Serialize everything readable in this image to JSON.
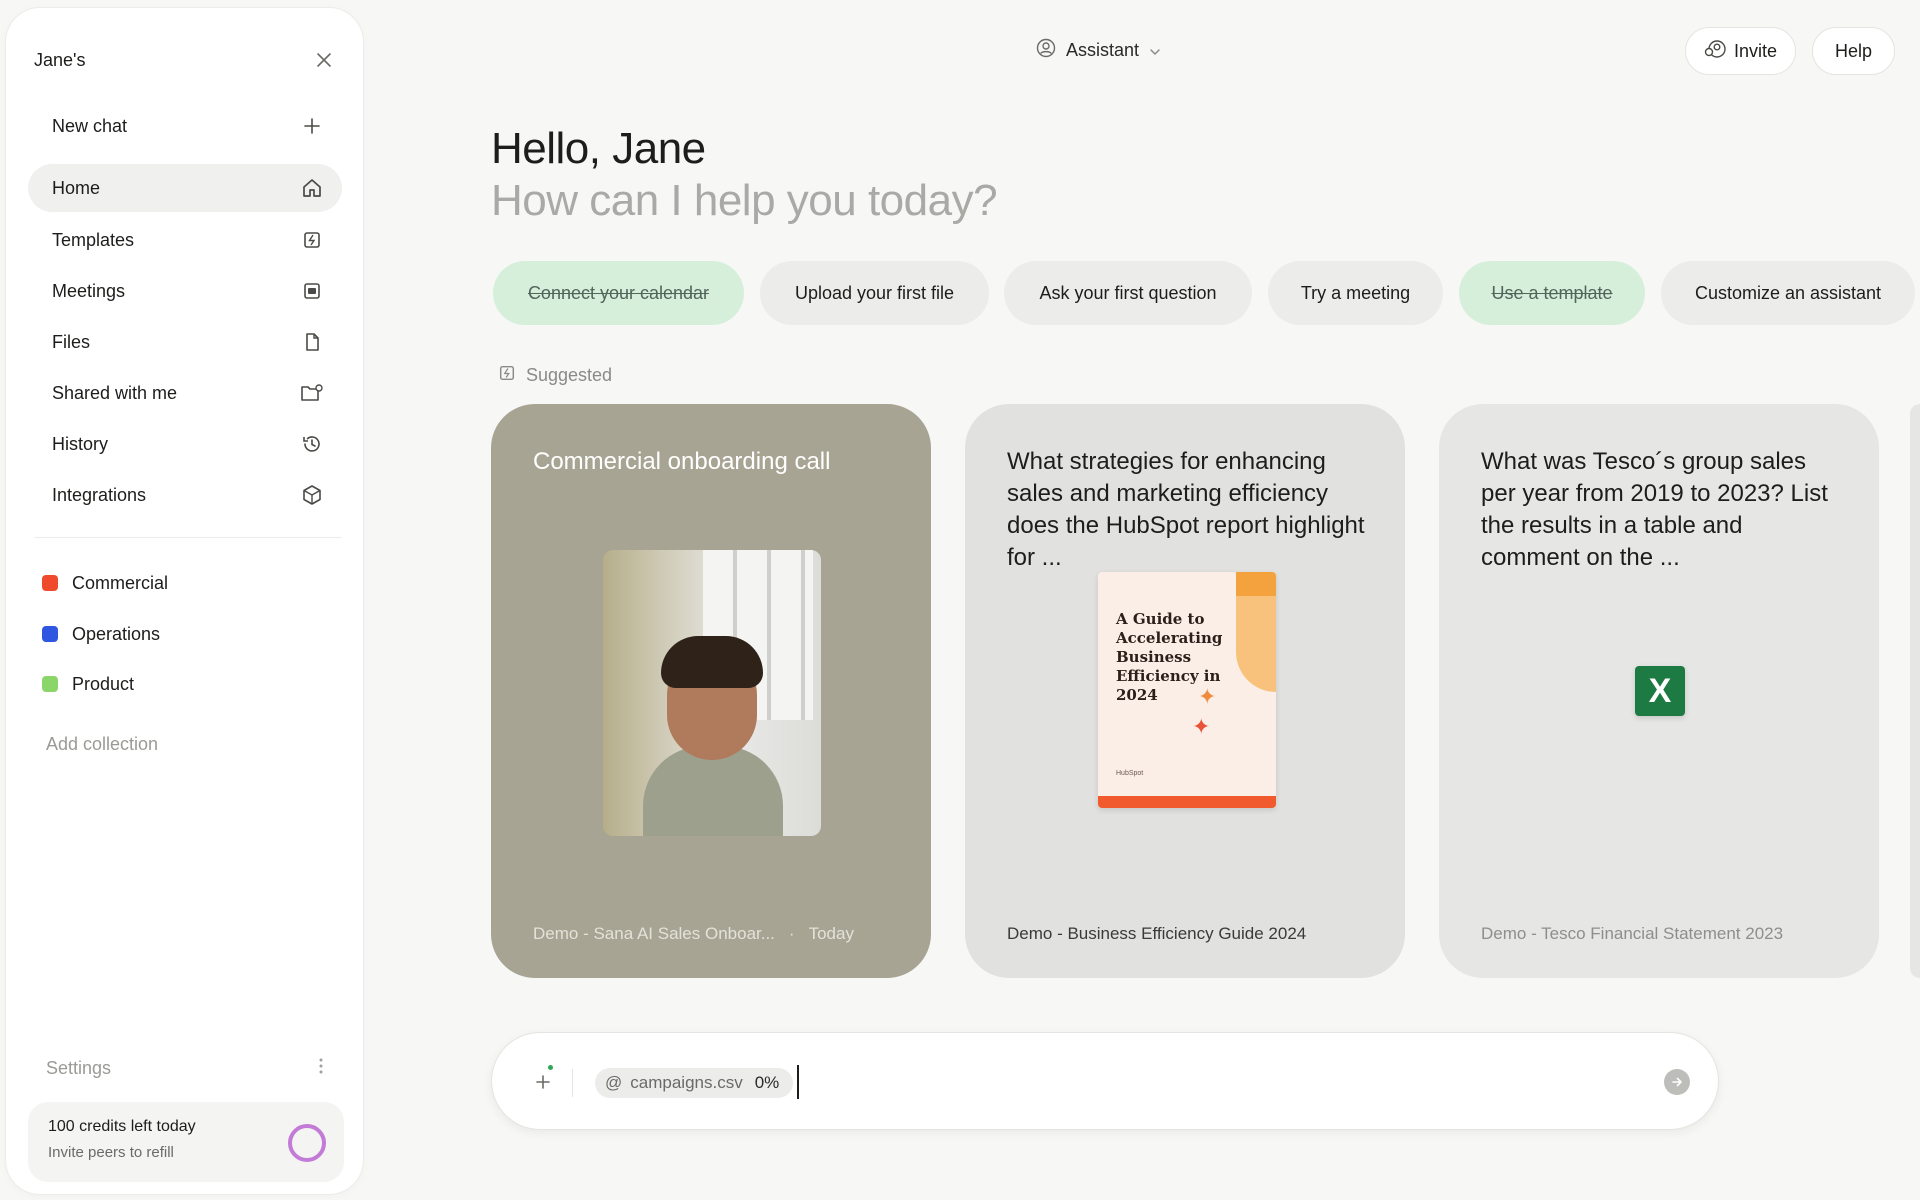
{
  "sidebar": {
    "workspace": "Jane's",
    "new_chat": "New chat",
    "nav": [
      {
        "label": "Home",
        "icon": "home-icon"
      },
      {
        "label": "Templates",
        "icon": "template-icon"
      },
      {
        "label": "Meetings",
        "icon": "video-icon"
      },
      {
        "label": "Files",
        "icon": "file-icon"
      },
      {
        "label": "Shared with me",
        "icon": "shared-folder-icon"
      },
      {
        "label": "History",
        "icon": "history-icon"
      },
      {
        "label": "Integrations",
        "icon": "cube-icon"
      }
    ],
    "collections": [
      {
        "label": "Commercial",
        "color": "#f04a2c"
      },
      {
        "label": "Operations",
        "color": "#2e56e0"
      },
      {
        "label": "Product",
        "color": "#8ad66a"
      }
    ],
    "add_collection": "Add collection",
    "settings": "Settings",
    "credits_title": "100 credits left today",
    "credits_sub": "Invite peers to refill"
  },
  "topbar": {
    "assistant": "Assistant",
    "invite": "Invite",
    "help": "Help"
  },
  "greeting": {
    "hello": "Hello, Jane",
    "sub": "How can I help you today?"
  },
  "chips": [
    {
      "label": "Connect your calendar",
      "done": true
    },
    {
      "label": "Upload your first file",
      "done": false
    },
    {
      "label": "Ask your first question",
      "done": false
    },
    {
      "label": "Try a meeting",
      "done": false
    },
    {
      "label": "Use a template",
      "done": true
    },
    {
      "label": "Customize an assistant",
      "done": false
    }
  ],
  "suggested_label": "Suggested",
  "cards": [
    {
      "title": "Commercial onboarding call",
      "footer": "Demo - Sana AI Sales Onboar...",
      "date": "Today"
    },
    {
      "title": "What strategies for enhancing sales and marketing efficiency does the HubSpot report highlight for ...",
      "footer": "Demo - Business Efficiency Guide 2024",
      "doc_title": "A Guide to Accelerating Business Efficiency in 2024",
      "doc_brand": "HubSpot"
    },
    {
      "title": "What was Tesco´s group sales per year from 2019 to 2023? List the results in a table and comment on the ...",
      "footer": "Demo - Tesco Financial Statement 2023",
      "xls_letter": "X"
    }
  ],
  "composer": {
    "attachment": "campaigns.csv",
    "attachment_prefix": "@",
    "progress": "0%"
  }
}
